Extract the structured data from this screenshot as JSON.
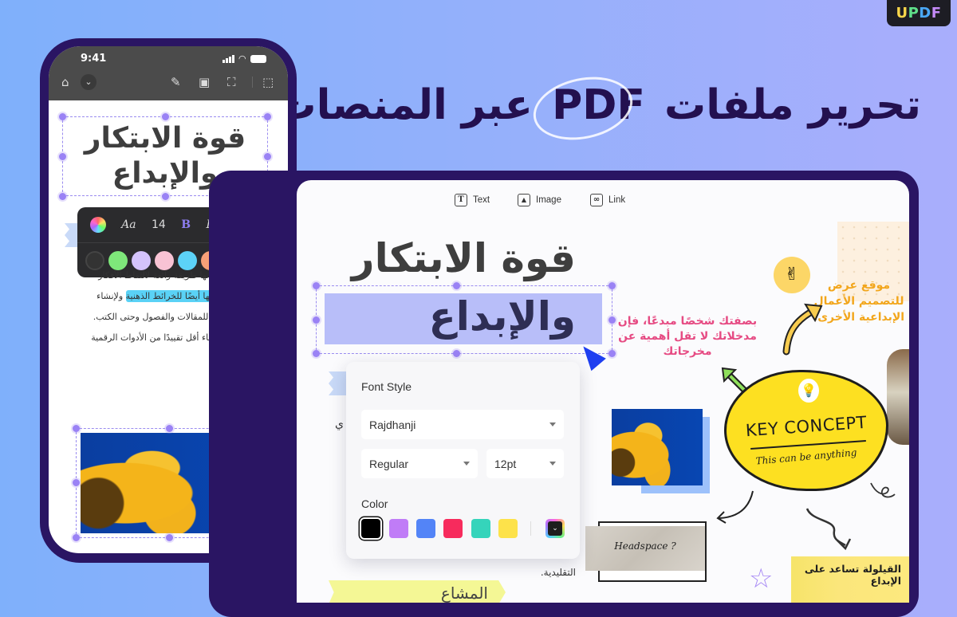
{
  "brand": {
    "logo": [
      "U",
      "P",
      "D",
      "F"
    ]
  },
  "headline": {
    "before": "تحرير ملفات ",
    "highlight": "PDF",
    "after": " عبر المنصات"
  },
  "phone": {
    "status": {
      "time": "9:41"
    },
    "toolbar": {
      "icons": [
        "home-icon",
        "chevron-down-icon",
        "highlighter-icon",
        "image-text-icon",
        "replace-image-icon",
        "select-area-icon"
      ]
    },
    "title": "قوة الابتكار والإبداع",
    "format_bar": {
      "font_label": "Aa",
      "size": "14",
      "bold": "B",
      "italic": "I",
      "colors": [
        "#333333",
        "#7ee77a",
        "#d4c3fb",
        "#f8c3d4",
        "#5cd2f7",
        "#f8a077"
      ],
      "more": "›"
    },
    "body": {
      "line1": "أحتفظ بـ ... فيه. إنها طريقة رائعة لالتقاط الأفكار وتنظيمها.",
      "highlighted": "أستخدمها أيضًا للخرائط الذهنية",
      "line2_rest": " ولإنشاء الخطوط العريضة للمقالات والفصول وحتى الكتب. أجد السبورة البيضاء أقل تقييدًا من الأدوات الرقمية التقليدية."
    }
  },
  "desktop": {
    "toolbar": [
      {
        "icon": "text-icon",
        "glyph": "T",
        "label": "Text"
      },
      {
        "icon": "image-icon",
        "glyph": "▲",
        "label": "Image"
      },
      {
        "icon": "link-icon",
        "glyph": "∞",
        "label": "Link"
      }
    ],
    "title_line1": "قوة الابتكار",
    "title_line2": "والإبداع",
    "pink_note": "بصفتك شخصًا مبدعًا، فإن مدخلاتك لا تقل أهمية عن مخرجاتك",
    "orange_note": "موقع عرض للتصميم الأعمال الإبداعية الأخرى.",
    "key_concept": {
      "title": "KEY CONCEPT",
      "subtitle": "This can be anything"
    },
    "headspace": "Headspace ?",
    "yellow_note": "القيلولة تساعد على الإبداع",
    "body_fragment": "التقليدية.",
    "bottom_heading": "المشاع الإبداعي",
    "fragment_ya": "ي"
  },
  "font_panel": {
    "title": "Font Style",
    "font_family": "Rajdhanji",
    "weight": "Regular",
    "size": "12pt",
    "color_label": "Color",
    "colors": [
      "#000000",
      "#c07cf7",
      "#5384f7",
      "#f72b5d",
      "#35d4bb",
      "#fde24a"
    ],
    "selected_color": "#000000"
  }
}
